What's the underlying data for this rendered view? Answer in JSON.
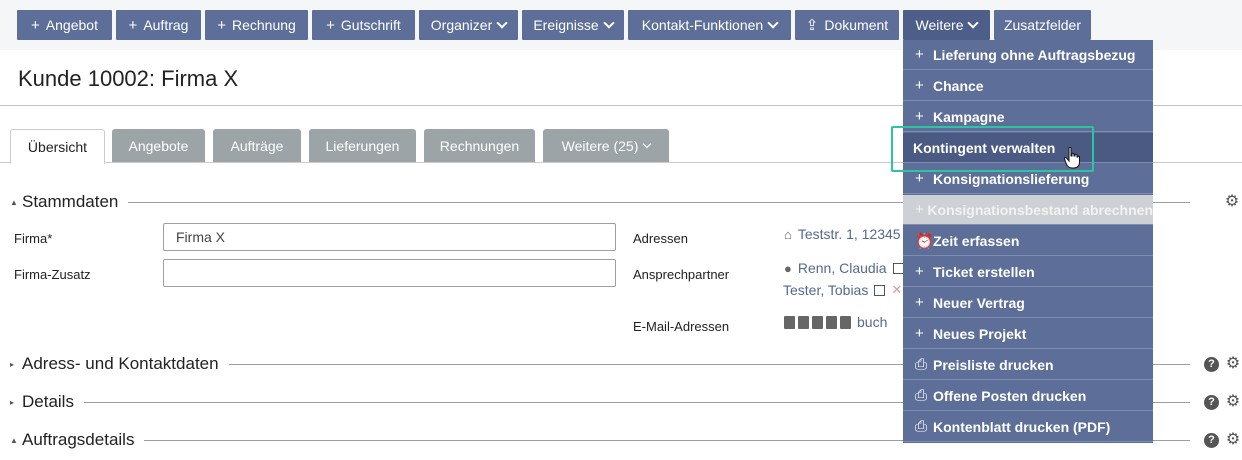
{
  "toolbar": {
    "buttons": [
      {
        "label": "Angebot",
        "icon": "plus"
      },
      {
        "label": "Auftrag",
        "icon": "plus"
      },
      {
        "label": "Rechnung",
        "icon": "plus"
      },
      {
        "label": "Gutschrift",
        "icon": "plus"
      },
      {
        "label": "Organizer",
        "icon": "chevron-down"
      },
      {
        "label": "Ereignisse",
        "icon": "chevron-down"
      },
      {
        "label": "Kontakt-Funktionen",
        "icon": "chevron-down"
      },
      {
        "label": "Dokument",
        "icon": "upload"
      },
      {
        "label": "Weitere",
        "icon": "chevron-down"
      },
      {
        "label": "Zusatzfelder",
        "icon": ""
      }
    ]
  },
  "page": {
    "title": "Kunde 10002: Firma X"
  },
  "tabs": [
    {
      "label": "Übersicht",
      "active": true
    },
    {
      "label": "Angebote"
    },
    {
      "label": "Aufträge"
    },
    {
      "label": "Lieferungen"
    },
    {
      "label": "Rechnungen"
    },
    {
      "label": "Weitere (25)"
    }
  ],
  "sections": {
    "stammdaten": "Stammdaten",
    "adress": "Adress- und Kontaktdaten",
    "details": "Details",
    "auftrag": "Auftragsdetails"
  },
  "form": {
    "firma_label": "Firma*",
    "firma_value": "Firma X",
    "zusatz_label": "Firma-Zusatz",
    "zusatz_value": "",
    "adressen_label": "Adressen",
    "adressen_value": "Teststr. 1, 12345",
    "ansprech_label": "Ansprechpartner",
    "ansprech_1": "Renn, Claudia",
    "ansprech_2": "Tester, Tobias",
    "email_label": "E-Mail-Adressen",
    "email_value": "buch"
  },
  "dropdown": {
    "items": [
      {
        "label": "Lieferung ohne Auftragsbezug",
        "icon": "plus"
      },
      {
        "label": "Chance",
        "icon": "plus"
      },
      {
        "label": "Kampagne",
        "icon": "plus"
      },
      {
        "label": "Kontingent verwalten",
        "icon": "",
        "hover": true
      },
      {
        "label": "Konsignationslieferung",
        "icon": "plus"
      },
      {
        "label": "Konsignationsbestand abrechnen",
        "icon": "plus",
        "disabled": true
      },
      {
        "label": "Zeit erfassen",
        "icon": "alarm-clock"
      },
      {
        "label": "Ticket erstellen",
        "icon": "plus"
      },
      {
        "label": "Neuer Vertrag",
        "icon": "plus"
      },
      {
        "label": "Neues Projekt",
        "icon": "plus"
      },
      {
        "label": "Preisliste drucken",
        "icon": "printer"
      },
      {
        "label": "Offene Posten drucken",
        "icon": "printer"
      },
      {
        "label": "Kontenblatt drucken (PDF)",
        "icon": "printer"
      }
    ]
  },
  "colors": {
    "button": "#5d6f98",
    "tab_inactive": "#9ca4a8",
    "link": "#56698f",
    "highlight": "#2bc5a0"
  }
}
